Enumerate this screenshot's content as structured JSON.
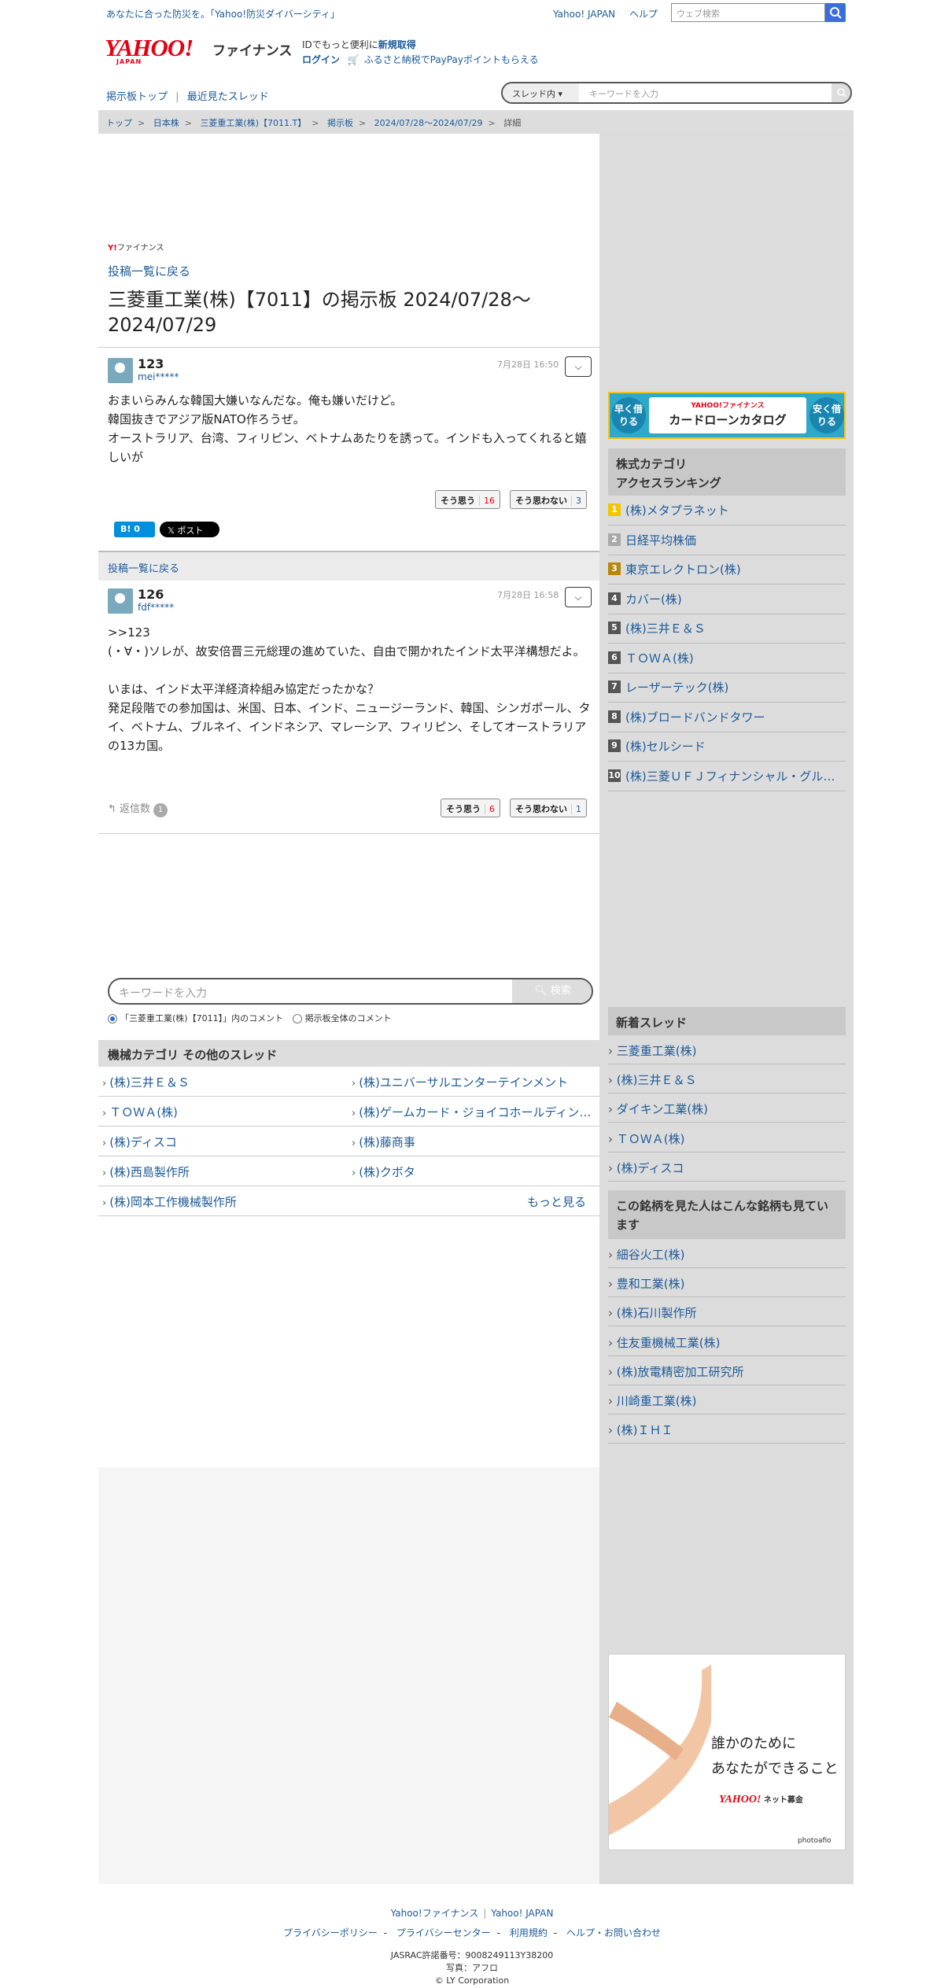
{
  "topbar": {
    "promo": "あなたに合った防災を。「Yahoo!防災ダイバーシティ」",
    "yahoo_japan": "Yahoo! JAPAN",
    "help": "ヘルプ",
    "web_search_placeholder": "ウェブ検索"
  },
  "logo": {
    "text": "YAHOO!",
    "sub": "JAPAN",
    "finance": "ファイナンス"
  },
  "login": {
    "id_prefix": "IDでもっと便利に",
    "signup": "新規取得",
    "login": "ログイン",
    "furusato": "ふるさと納税でPayPayポイントもらえる"
  },
  "subnav": {
    "top": "掲示板トップ",
    "recent": "最近見たスレッド",
    "search_scope": "スレッド内",
    "search_placeholder": "キーワードを入力"
  },
  "breadcrumb": [
    "トップ",
    "日本株",
    "三菱重工業(株)【7011.T】",
    "掲示板",
    "2024/07/28〜2024/07/29",
    "詳細"
  ],
  "mini_brand": {
    "y": "Y!",
    "text": "ファイナンス"
  },
  "back_to_list": "投稿一覧に戻る",
  "thread_title": "三菱重工業(株)【7011】の掲示板 2024/07/28〜2024/07/29",
  "posts": [
    {
      "no": "123",
      "user": "mei*****",
      "date": "7月28日 16:50",
      "body": "おまいらみんな韓国大嫌いなんだな。俺も嫌いだけど。\n韓国抜きでアジア版NATO作ろうぜ。\nオーストラリア、台湾、フィリピン、ベトナムあたりを誘って。インドも入ってくれると嬉しいが",
      "agree_label": "そう思う",
      "agree": "16",
      "disagree_label": "そう思わない",
      "disagree": "3"
    },
    {
      "no": "126",
      "user": "fdf*****",
      "date": "7月28日 16:58",
      "body": ">>123\n(・∀・)ソレが、故安倍晋三元総理の進めていた、自由で開かれたインド太平洋構想だよ。\n\nいまは、インド太平洋経済枠組み協定だったかな？\n発足段階での参加国は、米国、日本、インド、ニュージーランド、韓国、シンガポール、タイ、ベトナム、ブルネイ、インドネシア、マレーシア、フィリピン、そしてオーストラリアの13カ国。",
      "agree_label": "そう思う",
      "agree": "6",
      "disagree_label": "そう思わない",
      "disagree": "1"
    }
  ],
  "share": {
    "hatena": "B! 0",
    "x": "𝕏 ポスト"
  },
  "reply": {
    "label": "返信数",
    "count": "1"
  },
  "keyword_search": {
    "placeholder": "キーワードを入力",
    "button": "検索",
    "opt1": "「三菱重工業(株)【7011】」内のコメント",
    "opt2": "掲示板全体のコメント"
  },
  "machinery": {
    "title": "機械カテゴリ その他のスレッド",
    "rows": [
      [
        "(株)三井Ｅ＆Ｓ",
        "(株)ユニバーサルエンターテインメント"
      ],
      [
        "ＴＯＷＡ(株)",
        "(株)ゲームカード・ジョイコホールディングス"
      ],
      [
        "(株)ディスコ",
        "(株)藤商事"
      ],
      [
        "(株)西島製作所",
        "(株)クボタ"
      ]
    ],
    "last": "(株)岡本工作機械製作所",
    "more": "もっと見る"
  },
  "ad_card": {
    "left": "早く借りる",
    "brand": "YAHOO!ファイナンス",
    "title": "カードローンカタログ",
    "right": "安く借りる"
  },
  "ranking": {
    "title": "株式カテゴリ\nアクセスランキング",
    "items": [
      {
        "rank": "1",
        "name": "(株)メタプラネット",
        "color": "#f5c400"
      },
      {
        "rank": "2",
        "name": "日経平均株価",
        "color": "#a8a8a8"
      },
      {
        "rank": "3",
        "name": "東京エレクトロン(株)",
        "color": "#b8860b"
      },
      {
        "rank": "4",
        "name": "カバー(株)",
        "color": "#555555"
      },
      {
        "rank": "5",
        "name": "(株)三井Ｅ＆Ｓ",
        "color": "#555555"
      },
      {
        "rank": "6",
        "name": "ＴＯＷＡ(株)",
        "color": "#555555"
      },
      {
        "rank": "7",
        "name": "レーザーテック(株)",
        "color": "#555555"
      },
      {
        "rank": "8",
        "name": "(株)ブロードバンドタワー",
        "color": "#555555"
      },
      {
        "rank": "9",
        "name": "(株)セルシード",
        "color": "#555555"
      },
      {
        "rank": "10",
        "name": "(株)三菱ＵＦＪフィナンシャル・グループ",
        "color": "#555555"
      }
    ]
  },
  "new_threads": {
    "title": "新着スレッド",
    "items": [
      "三菱重工業(株)",
      "(株)三井Ｅ＆Ｓ",
      "ダイキン工業(株)",
      "ＴＯＷＡ(株)",
      "(株)ディスコ"
    ]
  },
  "also_viewed": {
    "title": "この銘柄を見た人はこんな銘柄も見ています",
    "items": [
      "細谷火工(株)",
      "豊和工業(株)",
      "(株)石川製作所",
      "住友重機械工業(株)",
      "(株)放電精密加工研究所",
      "川崎重工業(株)",
      "(株)ＩＨＩ"
    ]
  },
  "ad_photo": {
    "line1": "誰かのために",
    "line2": "あなたができること",
    "brand": "YAHOO!",
    "brand_sub": "ネット募金",
    "credit": "photoafio"
  },
  "footer": {
    "finance": "Yahoo!ファイナンス",
    "yj": "Yahoo! JAPAN",
    "links": [
      "プライバシーポリシー",
      "プライバシーセンター",
      "利用規約",
      "ヘルプ・お問い合わせ"
    ],
    "jasrac": "JASRAC許諾番号：9008249113Y38200",
    "photo": "写真：アフロ",
    "copyright": "© LY Corporation"
  }
}
